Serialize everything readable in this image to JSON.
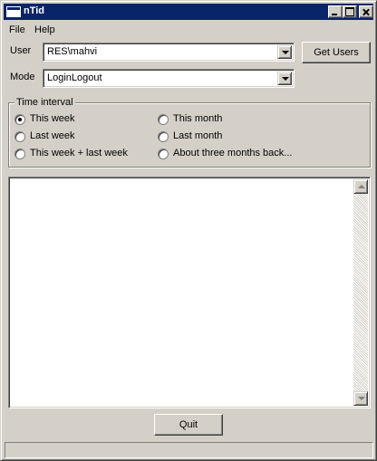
{
  "window": {
    "title": "nTid"
  },
  "menu": {
    "items": [
      "File",
      "Help"
    ]
  },
  "form": {
    "user_label": "User",
    "user_value": "RES\\mahvi",
    "mode_label": "Mode",
    "mode_value": "LoginLogout",
    "get_users_label": "Get Users"
  },
  "time_interval": {
    "legend": "Time interval",
    "options": [
      {
        "label": "This week",
        "checked": true
      },
      {
        "label": "Last week",
        "checked": false
      },
      {
        "label": "This week + last week",
        "checked": false
      },
      {
        "label": "This month",
        "checked": false
      },
      {
        "label": "Last month",
        "checked": false
      },
      {
        "label": "About three months back...",
        "checked": false
      }
    ]
  },
  "output": {
    "text": ""
  },
  "footer": {
    "quit_label": "Quit",
    "status_text": ""
  },
  "colors": {
    "titlebar": "#0a246a",
    "face": "#d4d0c8"
  }
}
